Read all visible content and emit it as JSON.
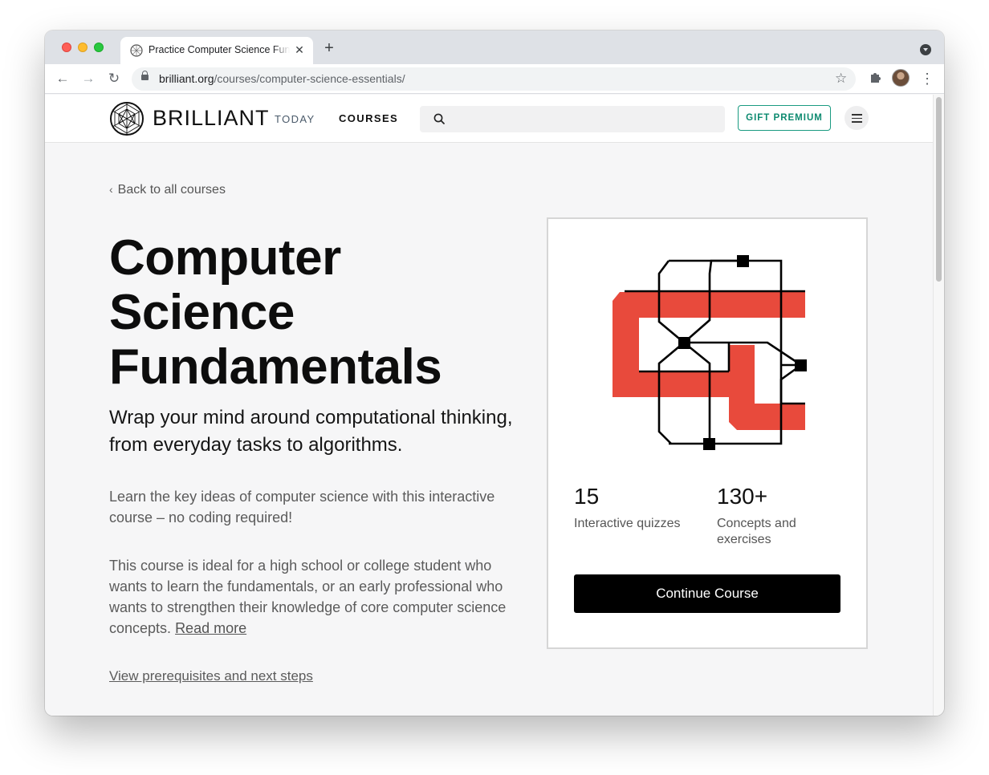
{
  "browser": {
    "tab_title": "Practice Computer Science Fundamentals",
    "tab_close": "✕",
    "new_tab": "+",
    "url_host": "brilliant.org",
    "url_path": "/courses/computer-science-essentials/",
    "nav": {
      "back": "←",
      "forward": "→",
      "reload": "↻"
    },
    "star": "☆",
    "menu": "⋮"
  },
  "header": {
    "logo_text": "BRILLIANT",
    "nav_today": "TODAY",
    "nav_courses": "COURSES",
    "gift_label": "GIFT PREMIUM"
  },
  "main": {
    "back_link": "Back to all courses",
    "title_line1": "Computer",
    "title_line2": "Science",
    "title_line3": "Fundamentals",
    "subtitle": "Wrap your mind around computational thinking, from everyday tasks to algorithms.",
    "desc1": "Learn the key ideas of computer science with this interactive course – no coding required!",
    "desc2": "This course is ideal for a high school or college student who wants to learn the fundamentals, or an early professional who wants to strengthen their knowledge of core computer science concepts.",
    "read_more": "Read more",
    "prereq_link": "View prerequisites and next steps"
  },
  "card": {
    "stats": [
      {
        "value": "15",
        "label": "Interactive quizzes"
      },
      {
        "value": "130+",
        "label": "Concepts and exercises"
      }
    ],
    "continue_label": "Continue Course"
  },
  "colors": {
    "brand_red": "#e84a3c",
    "gift_green": "#0d8a70",
    "button_black": "#000000"
  },
  "icons": [
    "search-icon",
    "lock-icon",
    "star-icon",
    "extensions-icon",
    "hamburger-icon",
    "chevron-left-icon"
  ]
}
